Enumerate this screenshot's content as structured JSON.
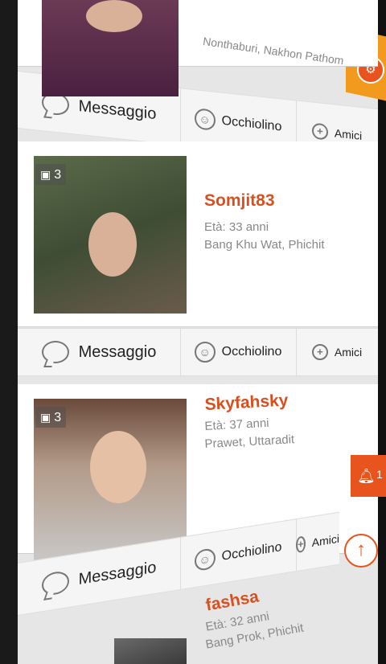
{
  "header": {
    "grid_icon": "grid-icon",
    "settings_icon": "gear-icon"
  },
  "cards": [
    {
      "name": "",
      "age": "",
      "location": "Nonthaburi, Nakhon Pathom",
      "photo_count": "",
      "actions": {
        "message": "Messaggio",
        "wink": "Occhiolino",
        "friends": "Amici"
      }
    },
    {
      "name": "Somjit83",
      "age": "Età: 33 anni",
      "location": "Bang Khu Wat, Phichit",
      "photo_count": "3",
      "actions": {
        "message": "Messaggio",
        "wink": "Occhiolino",
        "friends": "Amici"
      }
    },
    {
      "name": "Skyfahsky",
      "age": "Età: 37 anni",
      "location": "Prawet, Uttaradit",
      "photo_count": "3",
      "actions": {
        "message": "Messaggio",
        "wink": "Occhiolino",
        "friends": "Amici"
      }
    },
    {
      "name": "fashsa",
      "age": "Età: 32 anni",
      "location": "Bang Prok, Phichit",
      "photo_count": "",
      "actions": {}
    }
  ],
  "notifications": {
    "count": "1"
  },
  "colors": {
    "accent": "#e8541e",
    "secondary": "#f29a1d"
  }
}
